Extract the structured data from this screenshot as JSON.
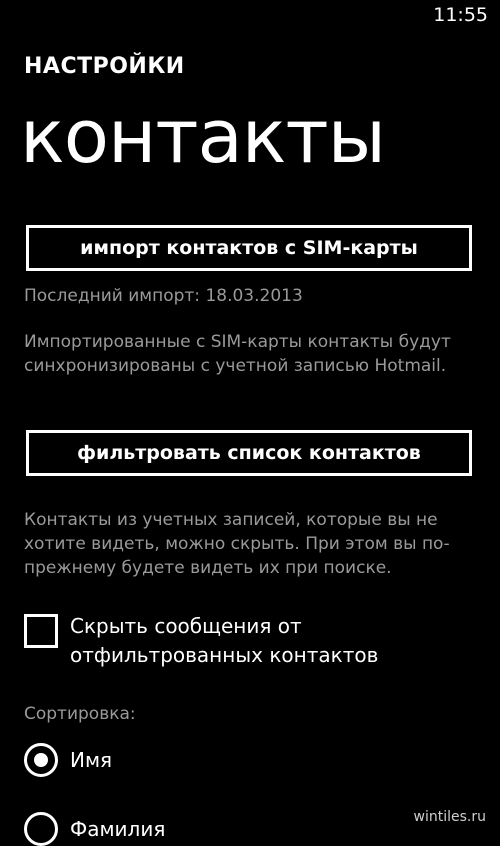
{
  "status_bar": {
    "time": "11:55"
  },
  "header": {
    "section": "НАСТРОЙКИ",
    "title": "контакты"
  },
  "import": {
    "button_label": "импорт контактов с SIM-карты",
    "last_import": "Последний импорт: 18.03.2013",
    "description": "Импортированные с SIM-карты контакты будут синхронизированы с учетной записью Hotmail."
  },
  "filter": {
    "button_label": "фильтровать список контактов",
    "description": "Контакты из учетных записей, которые вы не хотите видеть, можно скрыть. При этом вы по-прежнему будете видеть их при поиске."
  },
  "hide_messages": {
    "label": "Скрыть сообщения от отфильтрованных контактов",
    "checked": false
  },
  "sort": {
    "label": "Сортировка:",
    "options": [
      {
        "label": "Имя",
        "selected": true
      },
      {
        "label": "Фамилия",
        "selected": false
      }
    ]
  },
  "watermark": "wintiles.ru",
  "colors": {
    "background": "#000000",
    "foreground": "#ffffff",
    "subtle": "#9a9a9a"
  }
}
